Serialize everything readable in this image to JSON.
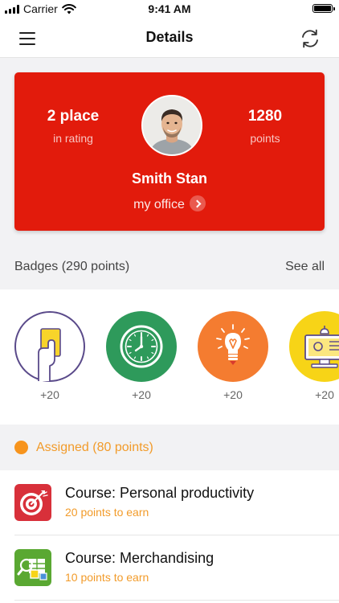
{
  "status_bar": {
    "carrier": "Carrier",
    "time": "9:41 AM"
  },
  "nav": {
    "title": "Details"
  },
  "profile": {
    "rank_value": "2 place",
    "rank_label": "in rating",
    "points_value": "1280",
    "points_label": "points",
    "name": "Smith Stan",
    "office_link": "my office"
  },
  "badges": {
    "title": "Badges (290 points)",
    "see_all": "See all",
    "items": [
      {
        "icon": "yellow-card-icon",
        "points": "+20",
        "color": "#ffffff"
      },
      {
        "icon": "clock-icon",
        "points": "+20",
        "color": "#2e9a5b"
      },
      {
        "icon": "lightbulb-icon",
        "points": "+20",
        "color": "#f47c30"
      },
      {
        "icon": "computer-icon",
        "points": "+20",
        "color": "#f7d417"
      }
    ]
  },
  "assigned": {
    "title": "Assigned (80 points)",
    "accent": "#f29b2a",
    "courses": [
      {
        "icon": "target-icon",
        "title": "Course: Personal productivity",
        "subtitle": "20 points to earn",
        "color": "#d8303a"
      },
      {
        "icon": "merchandising-icon",
        "title": "Course: Merchandising",
        "subtitle": "10 points to earn",
        "color": "#5aa832"
      }
    ]
  },
  "colors": {
    "brand_red": "#e21b0c",
    "accent_orange": "#f7941d"
  }
}
